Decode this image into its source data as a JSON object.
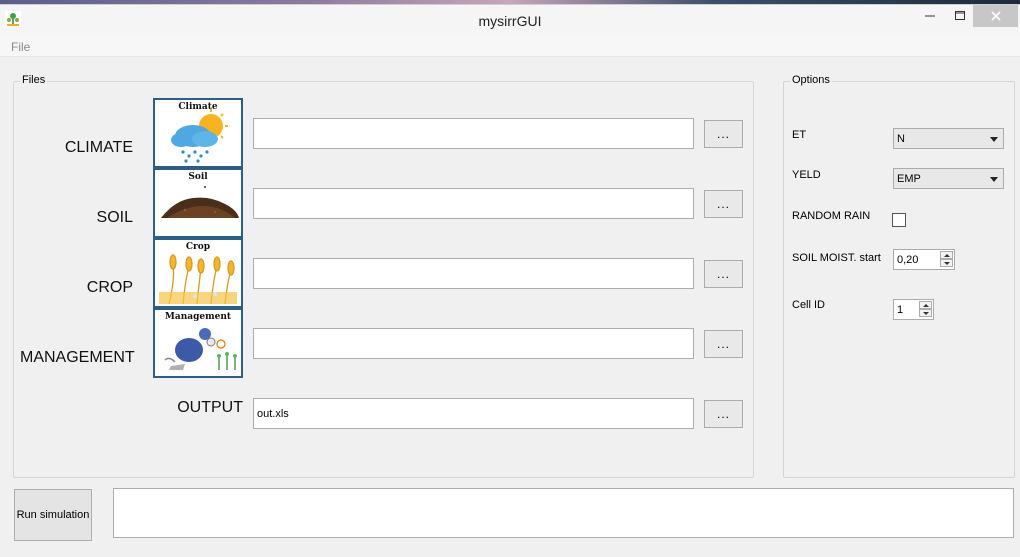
{
  "window": {
    "title": "mysirrGUI",
    "minimize_glyph": "—",
    "maximize_glyph": "☐",
    "close_glyph": "✕"
  },
  "menu": {
    "file_label": "File"
  },
  "files_group": {
    "title": "Files",
    "rows": [
      {
        "label": "CLIMATE",
        "thumb_title": "Climate",
        "thumb_icon": "weather-rain-sun-icon",
        "value": "",
        "browse_label": "..."
      },
      {
        "label": "SOIL",
        "thumb_title": "Soil",
        "thumb_icon": "soil-pile-icon",
        "value": "",
        "browse_label": "..."
      },
      {
        "label": "CROP",
        "thumb_title": "Crop",
        "thumb_icon": "wheat-crop-icon",
        "value": "",
        "browse_label": "..."
      },
      {
        "label": "MANAGEMENT",
        "thumb_title": "Management",
        "thumb_icon": "farmer-watering-icon",
        "value": "",
        "browse_label": "..."
      }
    ],
    "output": {
      "label": "OUTPUT",
      "value": "out.xls",
      "browse_label": "..."
    }
  },
  "options_group": {
    "title": "Options",
    "et": {
      "label": "ET",
      "value": "N"
    },
    "yeld": {
      "label": "YELD",
      "value": "EMP"
    },
    "random_rain": {
      "label": "RANDOM RAIN",
      "checked": false
    },
    "soil_moist": {
      "label": "SOIL MOIST. start",
      "value": "0,20"
    },
    "cell_id": {
      "label": "Cell ID",
      "value": "1"
    }
  },
  "actions": {
    "run_label": "Run simulation",
    "log_text": ""
  },
  "colors": {
    "thumb_border": "#2b5f86",
    "close_button_bg": "#c7c7c7"
  }
}
